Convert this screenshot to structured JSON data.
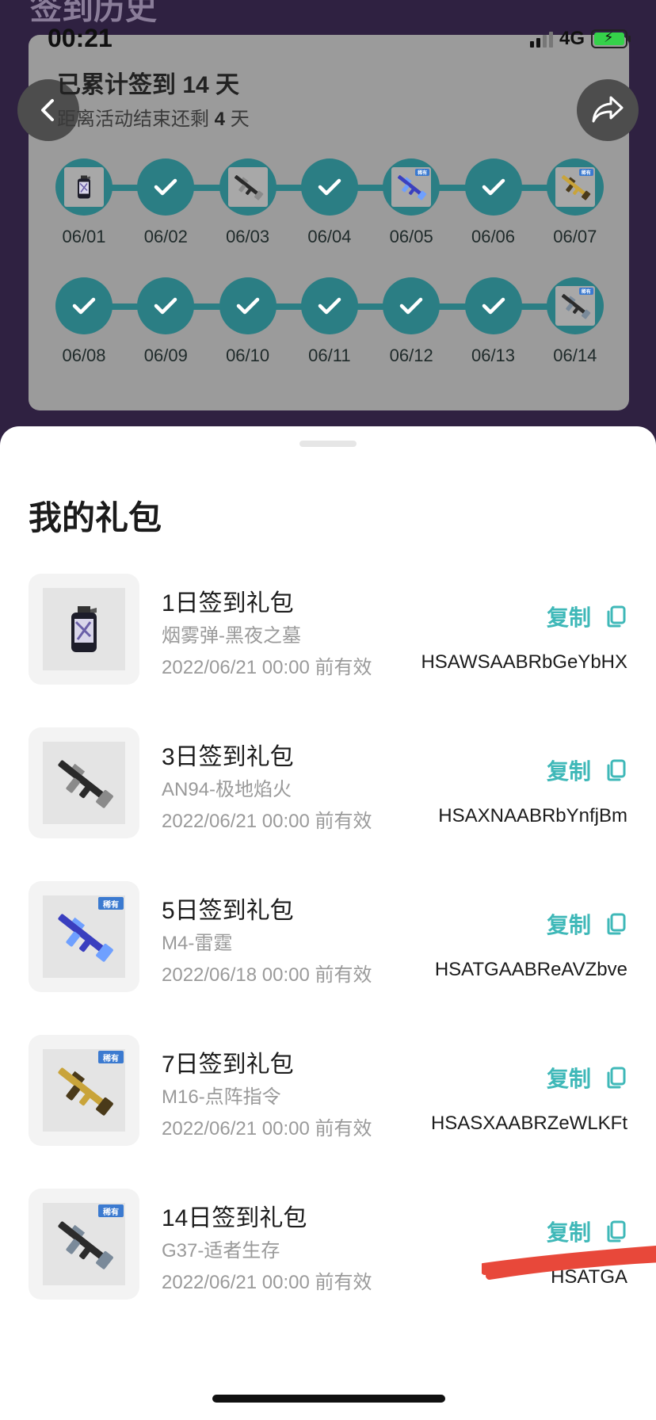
{
  "background": {
    "title": "签到历史"
  },
  "status_bar": {
    "time": "00:21",
    "network": "4G"
  },
  "summary": {
    "total_prefix": "已累计签到 ",
    "total_days": "14",
    "total_suffix": " 天",
    "remain_prefix": "距离活动结束还剩 ",
    "remain_days": "4",
    "remain_suffix": " 天"
  },
  "timeline": {
    "row1": [
      {
        "date": "06/01",
        "state": "reward",
        "icon": "smoke-grenade-icon"
      },
      {
        "date": "06/02",
        "state": "checked"
      },
      {
        "date": "06/03",
        "state": "reward",
        "icon": "rifle-icon"
      },
      {
        "date": "06/04",
        "state": "checked"
      },
      {
        "date": "06/05",
        "state": "reward",
        "icon": "rifle-blue-icon",
        "tag": "稀有"
      },
      {
        "date": "06/06",
        "state": "checked"
      },
      {
        "date": "06/07",
        "state": "reward",
        "icon": "rifle-gold-icon",
        "tag": "稀有"
      }
    ],
    "row2": [
      {
        "date": "06/08",
        "state": "checked"
      },
      {
        "date": "06/09",
        "state": "checked"
      },
      {
        "date": "06/10",
        "state": "checked"
      },
      {
        "date": "06/11",
        "state": "checked"
      },
      {
        "date": "06/12",
        "state": "checked"
      },
      {
        "date": "06/13",
        "state": "checked"
      },
      {
        "date": "06/14",
        "state": "reward",
        "icon": "rifle-dark-icon",
        "tag": "稀有"
      }
    ]
  },
  "sheet": {
    "title": "我的礼包",
    "copy_label": "复制",
    "gifts": [
      {
        "name": "1日签到礼包",
        "item": "烟雾弹-黑夜之墓",
        "valid": "2022/06/21 00:00 前有效",
        "code": "HSAWSAABRbGeYbHX",
        "icon": "smoke-grenade-icon"
      },
      {
        "name": "3日签到礼包",
        "item": "AN94-极地焰火",
        "valid": "2022/06/21 00:00 前有效",
        "code": "HSAXNAABRbYnfjBm",
        "icon": "rifle-icon"
      },
      {
        "name": "5日签到礼包",
        "item": "M4-雷霆",
        "valid": "2022/06/18 00:00 前有效",
        "code": "HSATGAABReAVZbve",
        "icon": "rifle-blue-icon",
        "tag": "稀有"
      },
      {
        "name": "7日签到礼包",
        "item": "M16-点阵指令",
        "valid": "2022/06/21 00:00 前有效",
        "code": "HSASXAABRZeWLKFt",
        "icon": "rifle-gold-icon",
        "tag": "稀有"
      },
      {
        "name": "14日签到礼包",
        "item": "G37-适者生存",
        "valid": "2022/06/21 00:00 前有效",
        "code": "HSATGA",
        "icon": "rifle-dark-icon",
        "tag": "稀有"
      }
    ]
  },
  "colors": {
    "accent": "#3fb8b8",
    "timeline": "#2b7e84",
    "rare_tag": "#3b7ad0",
    "redaction": "#e8483a"
  }
}
